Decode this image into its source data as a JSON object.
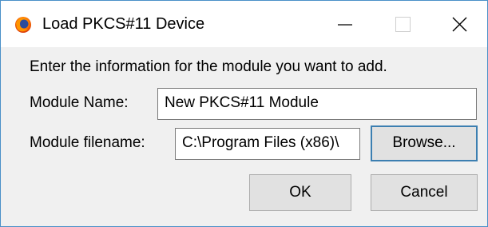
{
  "window": {
    "title": "Load PKCS#11 Device",
    "icon": "firefox-icon"
  },
  "titlebar_controls": {
    "minimize_icon": "minimize-icon",
    "maximize_icon": "maximize-icon",
    "close_icon": "close-icon"
  },
  "dialog": {
    "instruction": "Enter the information for the module you want to add.",
    "module_name_label": "Module Name:",
    "module_name_value": "New PKCS#11 Module",
    "module_filename_label": "Module filename:",
    "module_filename_value": "C:\\Program Files (x86)\\",
    "browse_button": "Browse...",
    "ok_button": "OK",
    "cancel_button": "Cancel"
  },
  "colors": {
    "window_border": "#4a90c8",
    "focus_border": "#3c7fb1",
    "dialog_background": "#f0f0f0"
  }
}
